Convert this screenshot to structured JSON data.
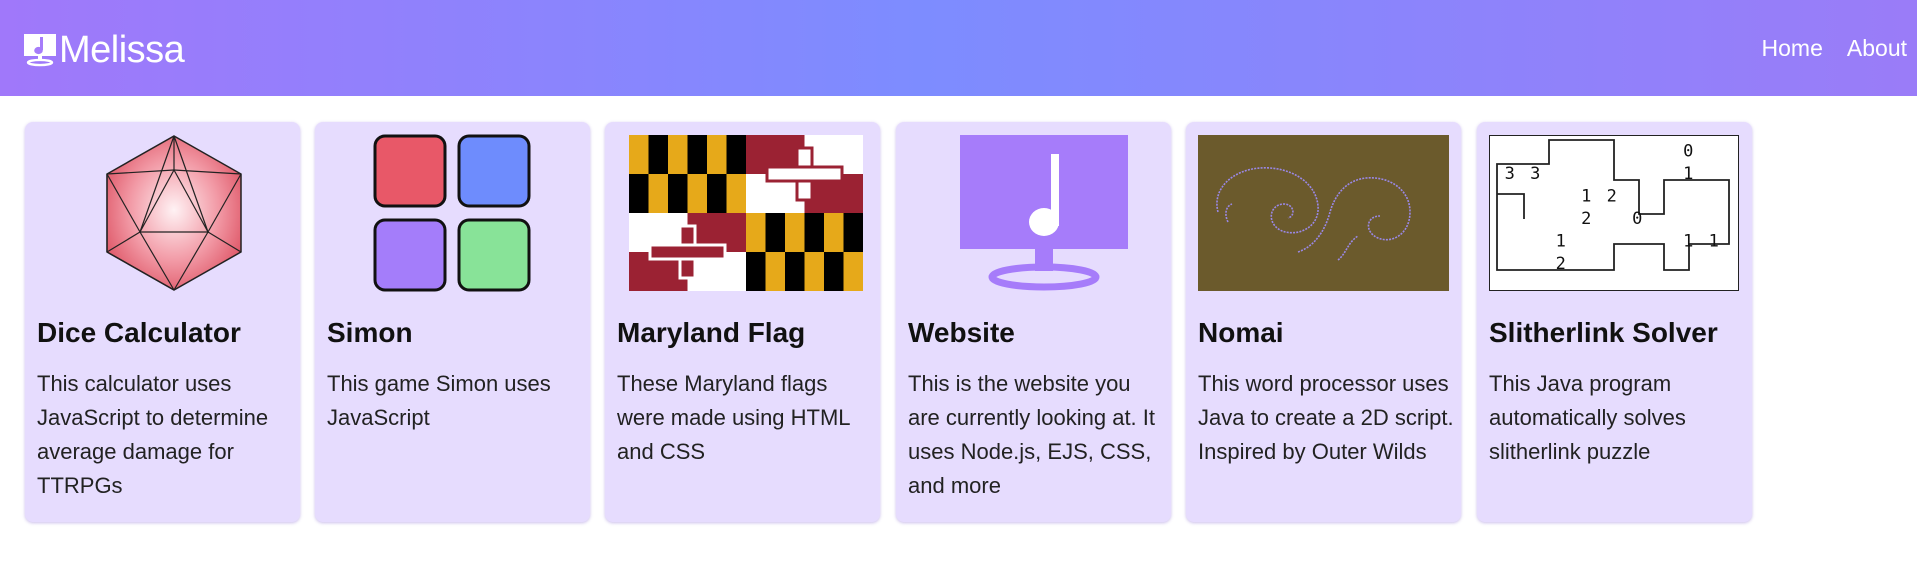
{
  "nav": {
    "brand": "Melissa",
    "brand_icon": "computer-music-note-icon",
    "links": [
      "Home",
      "About"
    ]
  },
  "colors": {
    "header_gradient_left": "#a078fa",
    "header_gradient_mid": "#7d8cff",
    "card_background": "#e6dcfe",
    "accent_purple": "#a67cfa"
  },
  "cards": [
    {
      "title": "Dice Calculator",
      "description": "This calculator uses JavaScript to determine average damage for TTRPGs",
      "image": "d20-dice-icon"
    },
    {
      "title": "Simon",
      "description": "This game Simon uses JavaScript",
      "image": "simon-buttons-icon"
    },
    {
      "title": "Maryland Flag",
      "description": "These Maryland flags were made using HTML and CSS",
      "image": "maryland-flag-image"
    },
    {
      "title": "Website",
      "description": "This is the website you are currently looking at. It uses Node.js, EJS, CSS, and more",
      "image": "computer-music-note-icon"
    },
    {
      "title": "Nomai",
      "description": "This word processor uses Java to create a 2D script. Inspired by Outer Wilds",
      "image": "nomai-spiral-script-image"
    },
    {
      "title": "Slitherlink Solver",
      "description": "This Java program automatically solves slitherlink puzzle",
      "image": "slitherlink-puzzle-image"
    }
  ],
  "slitherlink": {
    "clues": [
      {
        "row": 0,
        "col": 7,
        "value": "0"
      },
      {
        "row": 1,
        "col": 0,
        "value": "3"
      },
      {
        "row": 1,
        "col": 1,
        "value": "3"
      },
      {
        "row": 1,
        "col": 7,
        "value": "1"
      },
      {
        "row": 2,
        "col": 3,
        "value": "1"
      },
      {
        "row": 2,
        "col": 4,
        "value": "2"
      },
      {
        "row": 3,
        "col": 3,
        "value": "2"
      },
      {
        "row": 3,
        "col": 5,
        "value": "0"
      },
      {
        "row": 4,
        "col": 2,
        "value": "1"
      },
      {
        "row": 4,
        "col": 7,
        "value": "1"
      },
      {
        "row": 4,
        "col": 8,
        "value": "1"
      },
      {
        "row": 5,
        "col": 2,
        "value": "2"
      }
    ]
  }
}
